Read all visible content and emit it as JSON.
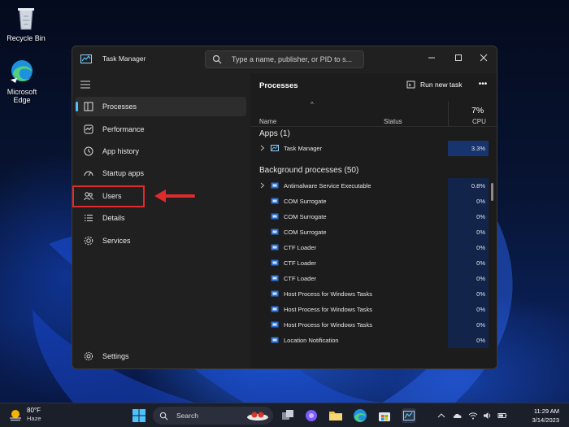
{
  "desktop": {
    "icons": [
      {
        "label": "Recycle Bin",
        "icon": "recycle-bin-icon"
      },
      {
        "label": "Microsoft Edge",
        "icon": "edge-icon"
      }
    ]
  },
  "window": {
    "title": "Task Manager",
    "search_placeholder": "Type a name, publisher, or PID to s...",
    "controls": [
      "minimize",
      "maximize",
      "close"
    ]
  },
  "sidebar": {
    "items": [
      {
        "label": "Processes",
        "icon": "processes-icon",
        "active": true
      },
      {
        "label": "Performance",
        "icon": "performance-icon"
      },
      {
        "label": "App history",
        "icon": "app-history-icon"
      },
      {
        "label": "Startup apps",
        "icon": "startup-apps-icon"
      },
      {
        "label": "Users",
        "icon": "users-icon",
        "highlighted": true
      },
      {
        "label": "Details",
        "icon": "details-icon"
      },
      {
        "label": "Services",
        "icon": "services-icon"
      }
    ],
    "footer": {
      "label": "Settings",
      "icon": "settings-icon"
    }
  },
  "main": {
    "title": "Processes",
    "run_task_label": "Run new task",
    "columns": {
      "name": "Name",
      "status": "Status",
      "cpu_total": "7%",
      "cpu": "CPU"
    },
    "apps_header": "Apps (1)",
    "apps": [
      {
        "name": "Task Manager",
        "cpu": "3.3%",
        "expandable": true
      }
    ],
    "bg_header": "Background processes (50)",
    "background": [
      {
        "name": "Antimalware Service Executable",
        "cpu": "0.8%",
        "expandable": true
      },
      {
        "name": "COM Surrogate",
        "cpu": "0%"
      },
      {
        "name": "COM Surrogate",
        "cpu": "0%"
      },
      {
        "name": "COM Surrogate",
        "cpu": "0%"
      },
      {
        "name": "CTF Loader",
        "cpu": "0%"
      },
      {
        "name": "CTF Loader",
        "cpu": "0%"
      },
      {
        "name": "CTF Loader",
        "cpu": "0%"
      },
      {
        "name": "Host Process for Windows Tasks",
        "cpu": "0%"
      },
      {
        "name": "Host Process for Windows Tasks",
        "cpu": "0%"
      },
      {
        "name": "Host Process for Windows Tasks",
        "cpu": "0%"
      },
      {
        "name": "Location Notification",
        "cpu": "0%"
      }
    ]
  },
  "taskbar": {
    "weather_temp": "80°F",
    "weather_cond": "Haze",
    "search_label": "Search",
    "time": "11:29 AM",
    "date": "3/14/2023"
  },
  "colors": {
    "accent": "#4cc2ff",
    "highlight": "#e02b2b",
    "cpu_cell": "#12244a"
  }
}
